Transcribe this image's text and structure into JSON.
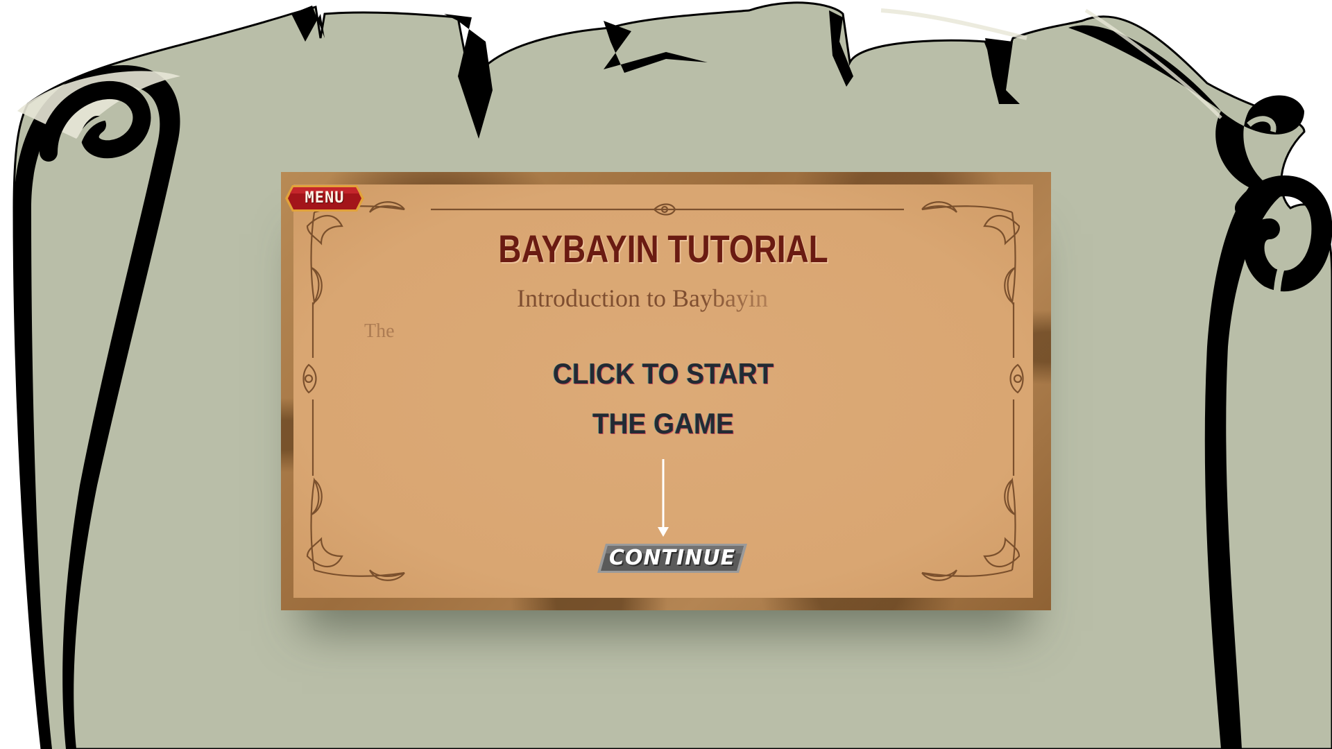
{
  "game": {
    "menu_label": "MENU",
    "title": "BAYBAYIN TUTORIAL",
    "subtitle": "Introduction to Baybayin",
    "faded_text": "The",
    "start_prompt": {
      "line1": "CLICK TO START",
      "line2": "THE GAME"
    },
    "continue_label": "CONTINUE"
  },
  "colors": {
    "scroll_fill": "#b9bea8",
    "scroll_outline": "#000000",
    "parchment": "#d9a672",
    "frame_wood": "#9c6d3d",
    "title": "#6a1b12",
    "menu_button": "#a3151a",
    "continue_button": "#5a5a5a",
    "prompt_text": "#222a33"
  },
  "icons": {
    "arrow": "arrow-down-icon",
    "corner_ornament": "flourish-ornament-icon"
  }
}
